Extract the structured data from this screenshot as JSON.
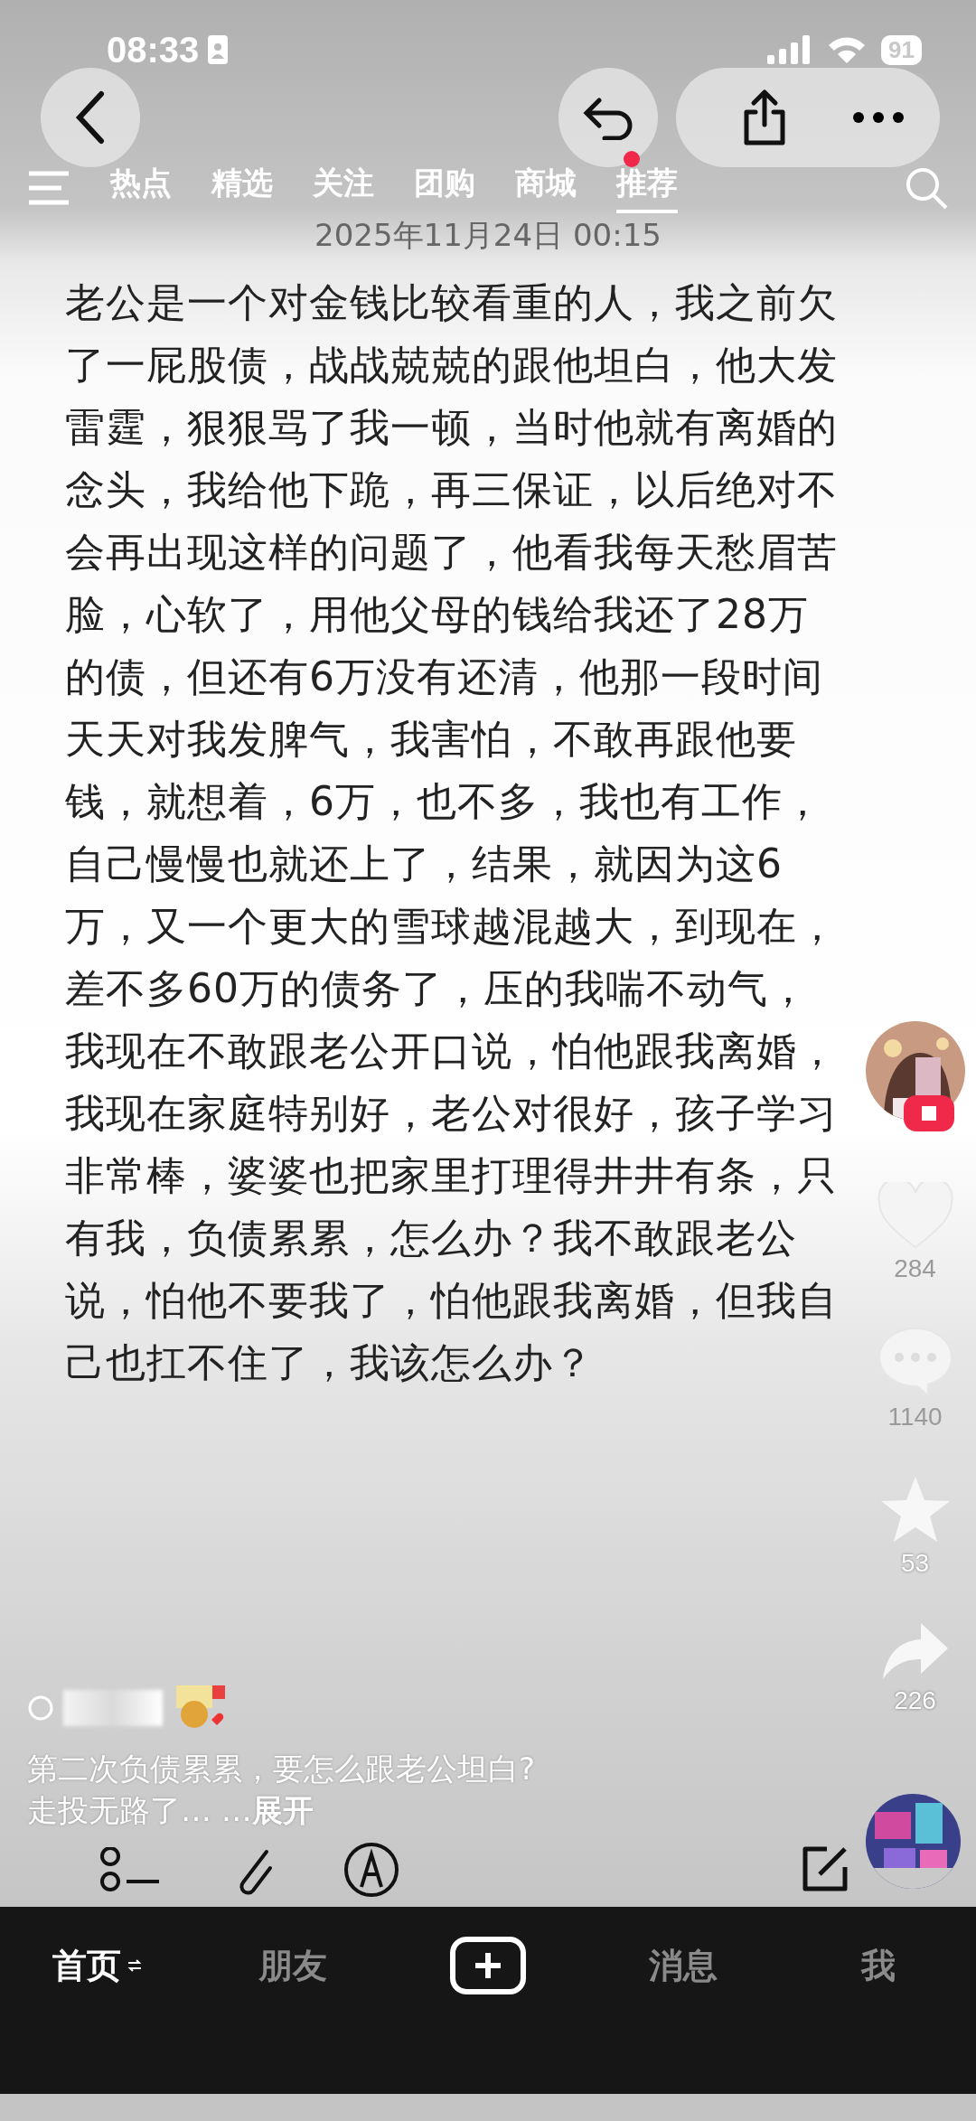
{
  "status_bar": {
    "time": "08:33",
    "battery": "91"
  },
  "tabs": [
    {
      "label": "热点",
      "selected": false
    },
    {
      "label": "精选",
      "selected": false
    },
    {
      "label": "关注",
      "selected": false
    },
    {
      "label": "团购",
      "selected": false
    },
    {
      "label": "商城",
      "selected": false
    },
    {
      "label": "推荐",
      "selected": true
    }
  ],
  "date": "2025年11月24日 00:15",
  "post_text": "老公是一个对金钱比较看重的人，我之前欠了一屁股债，战战兢兢的跟他坦白，他大发雷霆，狠狠骂了我一顿，当时他就有离婚的念头，我给他下跪，再三保证，以后绝对不会再出现这样的问题了，他看我每天愁眉苦脸，心软了，用他父母的钱给我还了28万的债，但还有6万没有还清，他那一段时间天天对我发脾气，我害怕，不敢再跟他要钱，就想着，6万，也不多，我也有工作，自己慢慢也就还上了，结果，就因为这6万，又一个更大的雪球越混越大，到现在，差不多60万的债务了，压的我喘不动气，我现在不敢跟老公开口说，怕他跟我离婚，我现在家庭特别好，老公对很好，孩子学习非常棒，婆婆也把家里打理得井井有条，只有我，负债累累，怎么办？我不敢跟老公说，怕他不要我了，怕他跟我离婚，但我自己也扛不住了，我该怎么办？",
  "actions": [
    {
      "kind": "like",
      "count": "284"
    },
    {
      "kind": "comment",
      "count": "1140"
    },
    {
      "kind": "favorite",
      "count": "53"
    },
    {
      "kind": "share",
      "count": "226"
    }
  ],
  "caption": {
    "title": "第二次负债累累，要怎么跟老公坦白?",
    "summary": "走投无路了… …",
    "more": "展开"
  },
  "nav": [
    {
      "kind": "tab",
      "label": "首页",
      "selected": true
    },
    {
      "kind": "tab",
      "label": "朋友",
      "selected": false
    },
    {
      "kind": "create"
    },
    {
      "kind": "tab",
      "label": "消息",
      "selected": false
    },
    {
      "kind": "tab",
      "label": "我",
      "selected": false
    }
  ]
}
